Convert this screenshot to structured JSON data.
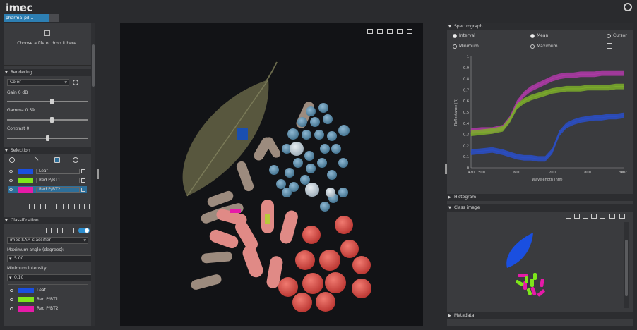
{
  "app": {
    "brand": "imec"
  },
  "tabs": [
    {
      "label": "pharma_pil…"
    },
    {
      "label": "+"
    }
  ],
  "drop": {
    "text": "Choose a file or drop it here."
  },
  "rendering": {
    "title": "Rendering",
    "mode": "Color",
    "gain_label": "Gain 0 dB",
    "gamma_label": "Gamma 0.59",
    "contrast_label": "Contrast 0",
    "gain_value": 0.55,
    "gamma_value": 0.55,
    "contrast_value": 0.5
  },
  "selection": {
    "title": "Selection",
    "classes": [
      {
        "name": "Leaf",
        "color": "#1a4fe0"
      },
      {
        "name": "Red P/BT1",
        "color": "#7de61a"
      },
      {
        "name": "Red P/BT2",
        "color": "#e61aa8"
      }
    ]
  },
  "classification": {
    "title": "Classification",
    "method": "imec SAM classifier",
    "max_angle_label": "Maximum angle (degrees):",
    "max_angle": "5.00",
    "min_intensity_label": "Minimum intensity:",
    "min_intensity": "0.10",
    "classes": [
      {
        "name": "Leaf",
        "color": "#1a4fe0"
      },
      {
        "name": "Red P/BT1",
        "color": "#7de61a"
      },
      {
        "name": "Red P/BT2",
        "color": "#e61aa8"
      }
    ]
  },
  "spectrograph": {
    "title": "Spectrograph",
    "options": {
      "interval": "Interval",
      "mean": "Mean",
      "cursor": "Cursor",
      "minimum": "Minimum",
      "maximum": "Maximum"
    }
  },
  "histogram": {
    "title": "Histogram"
  },
  "class_image": {
    "title": "Class image"
  },
  "metadata": {
    "title": "Metadata"
  },
  "chart_data": {
    "type": "line",
    "xlabel": "Wavelength (nm)",
    "ylabel": "Reflectance (R)",
    "xlim": [
      470,
      902
    ],
    "ylim": [
      0,
      1
    ],
    "x_ticks": [
      "470",
      "500",
      "600",
      "700",
      "800",
      "900",
      "902"
    ],
    "y_ticks": [
      "0",
      "0.1",
      "0.2",
      "0.3",
      "0.4",
      "0.5",
      "0.6",
      "0.7",
      "0.8",
      "0.9",
      "1"
    ],
    "x": [
      470,
      500,
      530,
      560,
      580,
      600,
      620,
      640,
      660,
      680,
      700,
      720,
      740,
      760,
      780,
      800,
      820,
      840,
      860,
      880,
      902
    ],
    "series": [
      {
        "color": "#b03aa8",
        "values": [
          0.33,
          0.34,
          0.34,
          0.36,
          0.44,
          0.58,
          0.66,
          0.71,
          0.74,
          0.77,
          0.8,
          0.82,
          0.83,
          0.83,
          0.84,
          0.84,
          0.84,
          0.85,
          0.85,
          0.85,
          0.85
        ]
      },
      {
        "color": "#7cae2a",
        "values": [
          0.31,
          0.32,
          0.33,
          0.35,
          0.43,
          0.55,
          0.6,
          0.63,
          0.65,
          0.67,
          0.69,
          0.7,
          0.71,
          0.71,
          0.71,
          0.72,
          0.72,
          0.72,
          0.72,
          0.73,
          0.73
        ]
      },
      {
        "color": "#2a4fc8",
        "values": [
          0.14,
          0.15,
          0.16,
          0.14,
          0.12,
          0.1,
          0.09,
          0.09,
          0.08,
          0.08,
          0.15,
          0.31,
          0.38,
          0.41,
          0.43,
          0.44,
          0.45,
          0.45,
          0.46,
          0.46,
          0.47
        ]
      }
    ],
    "band_width": 0.025
  }
}
